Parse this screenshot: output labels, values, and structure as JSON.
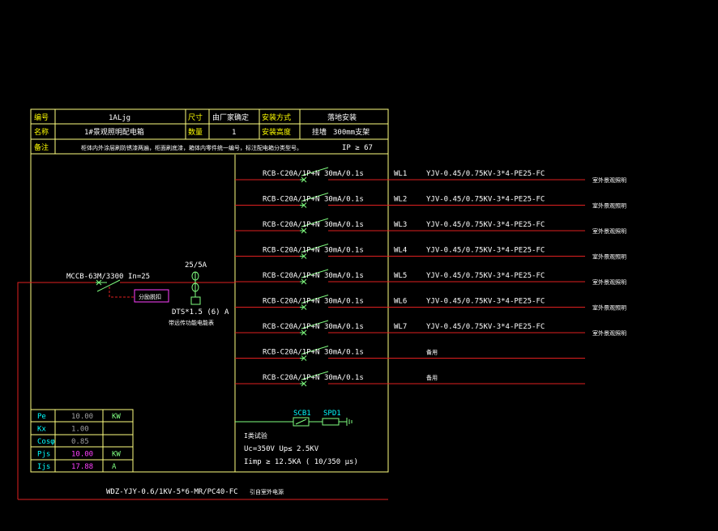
{
  "header": {
    "r1": [
      "编号",
      "1ALjg",
      "尺寸",
      "由厂家确定",
      "安装方式",
      "落地安装"
    ],
    "r2": [
      "名称",
      "1#景观照明配电箱",
      "数量",
      "1",
      "安装高度",
      "挂墙",
      "300mm支架"
    ],
    "r3": [
      "备注",
      "柜体内外涂层刷防锈漆两遍，柜面刷底漆，箱体内零件统一编号，标注配电箱分类型号。",
      "IP ≥ 67"
    ]
  },
  "incoming": {
    "breaker": "MCCB-63M/3300",
    "rating": "In=25",
    "shunt": "分励脱扣",
    "meter_ratio": "25/5A",
    "meter": "DTS*1.5 (6) A",
    "meter_note": "带远传功能电能表",
    "cable": "WDZ-YJY-0.6/1KV-5*6-MR/PC40-FC",
    "cable_note": "引自室外电源"
  },
  "circuits": [
    {
      "breaker": "RCB-C20A/1P+N",
      "rcd": "30mA/0.1s",
      "id": "WL1",
      "cable": "YJV-0.45/0.75KV-3*4-PE25-FC",
      "load": "室外景观照明"
    },
    {
      "breaker": "RCB-C20A/1P+N",
      "rcd": "30mA/0.1s",
      "id": "WL2",
      "cable": "YJV-0.45/0.75KV-3*4-PE25-FC",
      "load": "室外景观照明"
    },
    {
      "breaker": "RCB-C20A/1P+N",
      "rcd": "30mA/0.1s",
      "id": "WL3",
      "cable": "YJV-0.45/0.75KV-3*4-PE25-FC",
      "load": "室外景观照明"
    },
    {
      "breaker": "RCB-C20A/1P+N",
      "rcd": "30mA/0.1s",
      "id": "WL4",
      "cable": "YJV-0.45/0.75KV-3*4-PE25-FC",
      "load": "室外景观照明"
    },
    {
      "breaker": "RCB-C20A/1P+N",
      "rcd": "30mA/0.1s",
      "id": "WL5",
      "cable": "YJV-0.45/0.75KV-3*4-PE25-FC",
      "load": "室外景观照明"
    },
    {
      "breaker": "RCB-C20A/1P+N",
      "rcd": "30mA/0.1s",
      "id": "WL6",
      "cable": "YJV-0.45/0.75KV-3*4-PE25-FC",
      "load": "室外景观照明"
    },
    {
      "breaker": "RCB-C20A/1P+N",
      "rcd": "30mA/0.1s",
      "id": "WL7",
      "cable": "YJV-0.45/0.75KV-3*4-PE25-FC",
      "load": "室外景观照明"
    },
    {
      "breaker": "RCB-C20A/1P+N",
      "rcd": "30mA/0.1s",
      "id": "",
      "cable": "备用",
      "load": ""
    },
    {
      "breaker": "RCB-C20A/1P+N",
      "rcd": "30mA/0.1s",
      "id": "",
      "cable": "备用",
      "load": ""
    }
  ],
  "spd": {
    "scb": "SCB1",
    "spd": "SPD1",
    "class": "I类试验",
    "uc": "Uc=350V  Up≤ 2.5KV",
    "iimp": "Iimp ≥ 12.5KA ( 10/350 μs)"
  },
  "load_table": [
    {
      "param": "Pe",
      "value": "10.00",
      "unit": "KW"
    },
    {
      "param": "Kx",
      "value": "1.00",
      "unit": ""
    },
    {
      "param": "Cosφ",
      "value": "0.85",
      "unit": ""
    },
    {
      "param": "Pjs",
      "value": "10.00",
      "unit": "KW"
    },
    {
      "param": "Ijs",
      "value": "17.88",
      "unit": "A"
    }
  ],
  "colors": {
    "frame": "#ffff80",
    "wire": "#e02020",
    "text": "#ffffff",
    "symbol": "#80ff80",
    "label": "#ffff00",
    "cyan": "#00ffff",
    "magenta": "#ff40ff"
  }
}
